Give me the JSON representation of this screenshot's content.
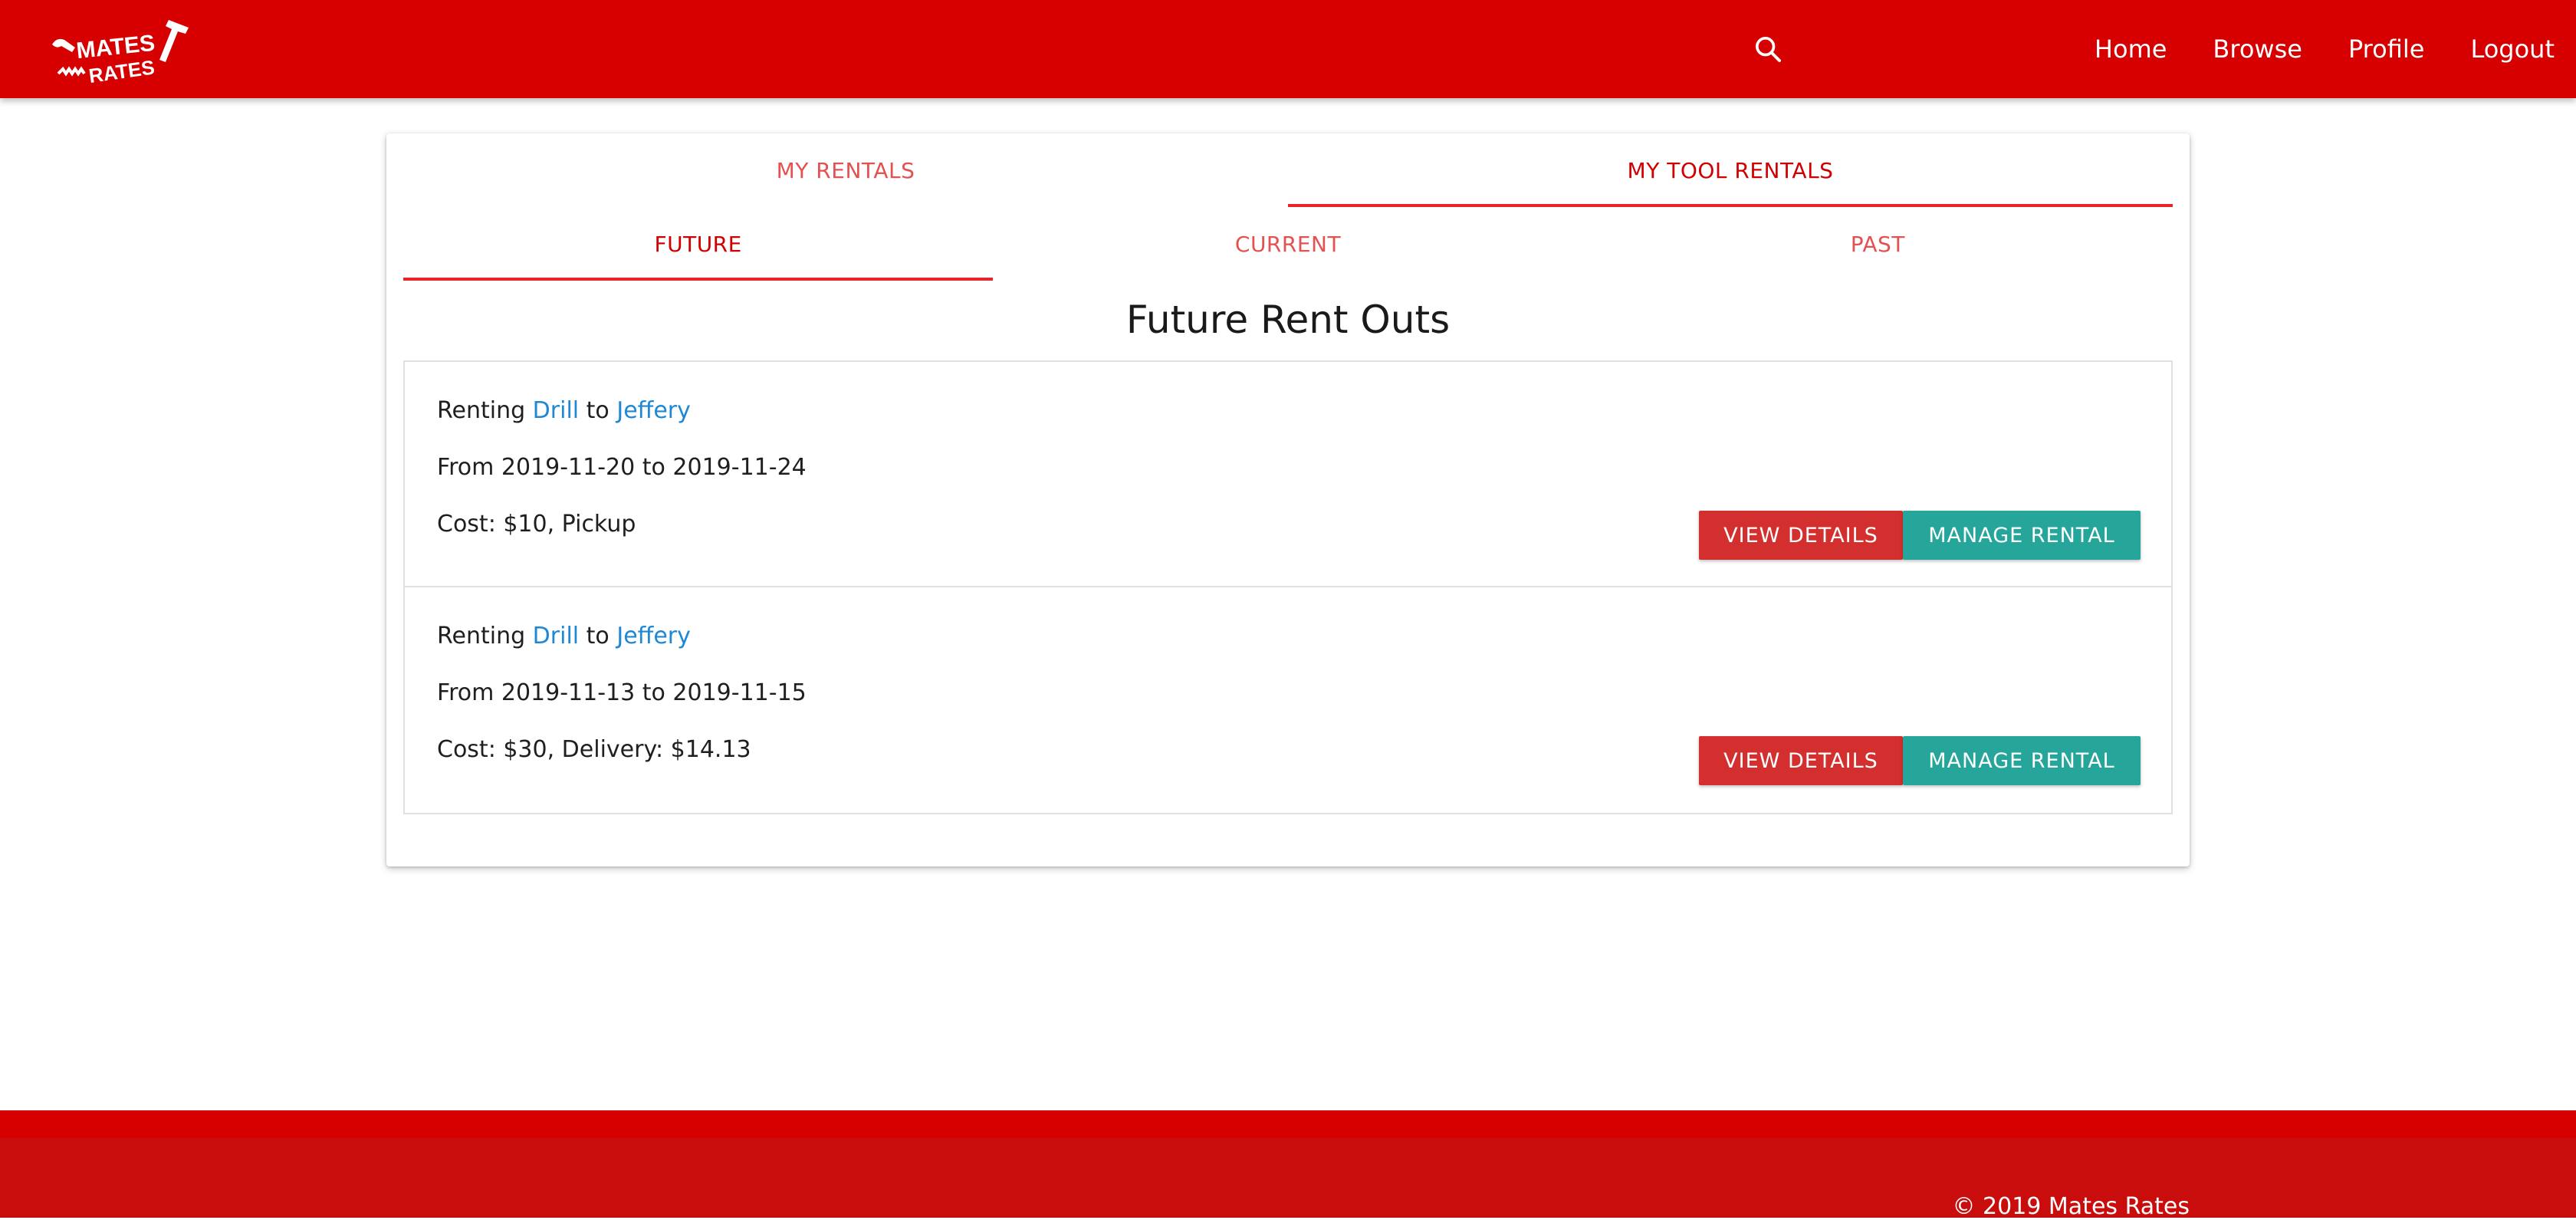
{
  "nav": {
    "logo_text_top": "MATES",
    "logo_text_bottom": "RATES",
    "links": [
      "Home",
      "Browse",
      "Profile",
      "Logout"
    ]
  },
  "tabs": {
    "main": [
      "MY RENTALS",
      "MY TOOL RENTALS"
    ],
    "main_active": "MY TOOL RENTALS",
    "sub": [
      "FUTURE",
      "CURRENT",
      "PAST"
    ],
    "sub_active": "FUTURE"
  },
  "section_title": "Future Rent Outs",
  "rentals": [
    {
      "prefix": "Renting",
      "tool": "Drill",
      "joiner": "to",
      "renter": "Jeffery",
      "dates": "From 2019-11-20 to 2019-11-24",
      "cost": "Cost: $10, Pickup",
      "view_label": "VIEW DETAILS",
      "manage_label": "MANAGE RENTAL"
    },
    {
      "prefix": "Renting",
      "tool": "Drill",
      "joiner": "to",
      "renter": "Jeffery",
      "dates": "From 2019-11-13 to 2019-11-15",
      "cost": "Cost: $30, Delivery: $14.13",
      "view_label": "VIEW DETAILS",
      "manage_label": "MANAGE RENTAL"
    }
  ],
  "footer": {
    "copyright": "© 2019 Mates Rates"
  },
  "colors": {
    "brand_red": "#d60000",
    "footer_dark_red": "#c90c0c",
    "details_button": "#d32f2f",
    "manage_button": "#26a69a",
    "link_blue": "#1e88d6"
  },
  "icons": {
    "search": "search-icon",
    "logo": "hammer-logo-icon"
  }
}
